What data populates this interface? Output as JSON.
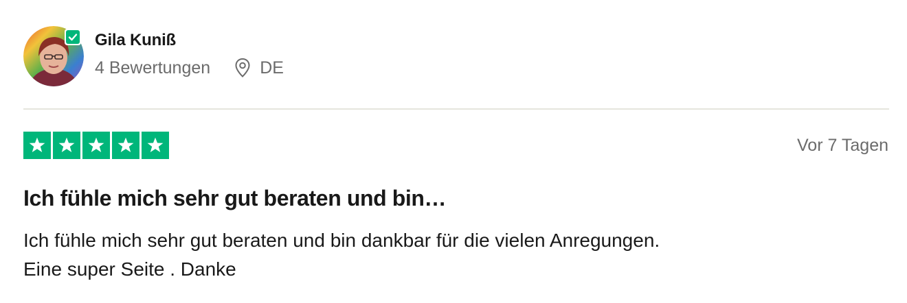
{
  "reviewer": {
    "name": "Gila Kuniß",
    "reviews_count": "4 Bewertungen",
    "country": "DE",
    "avatar_icon": "user-photo",
    "verified_icon": "verified-check-icon"
  },
  "review": {
    "rating": 5,
    "rating_max": 5,
    "star_color": "#00b67a",
    "date": "Vor 7 Tagen",
    "title": "Ich fühle mich sehr gut beraten und bin…",
    "body_lines": [
      "Ich fühle mich sehr gut beraten und bin dankbar für die vielen Anregungen.",
      "Eine super Seite . Danke"
    ]
  }
}
